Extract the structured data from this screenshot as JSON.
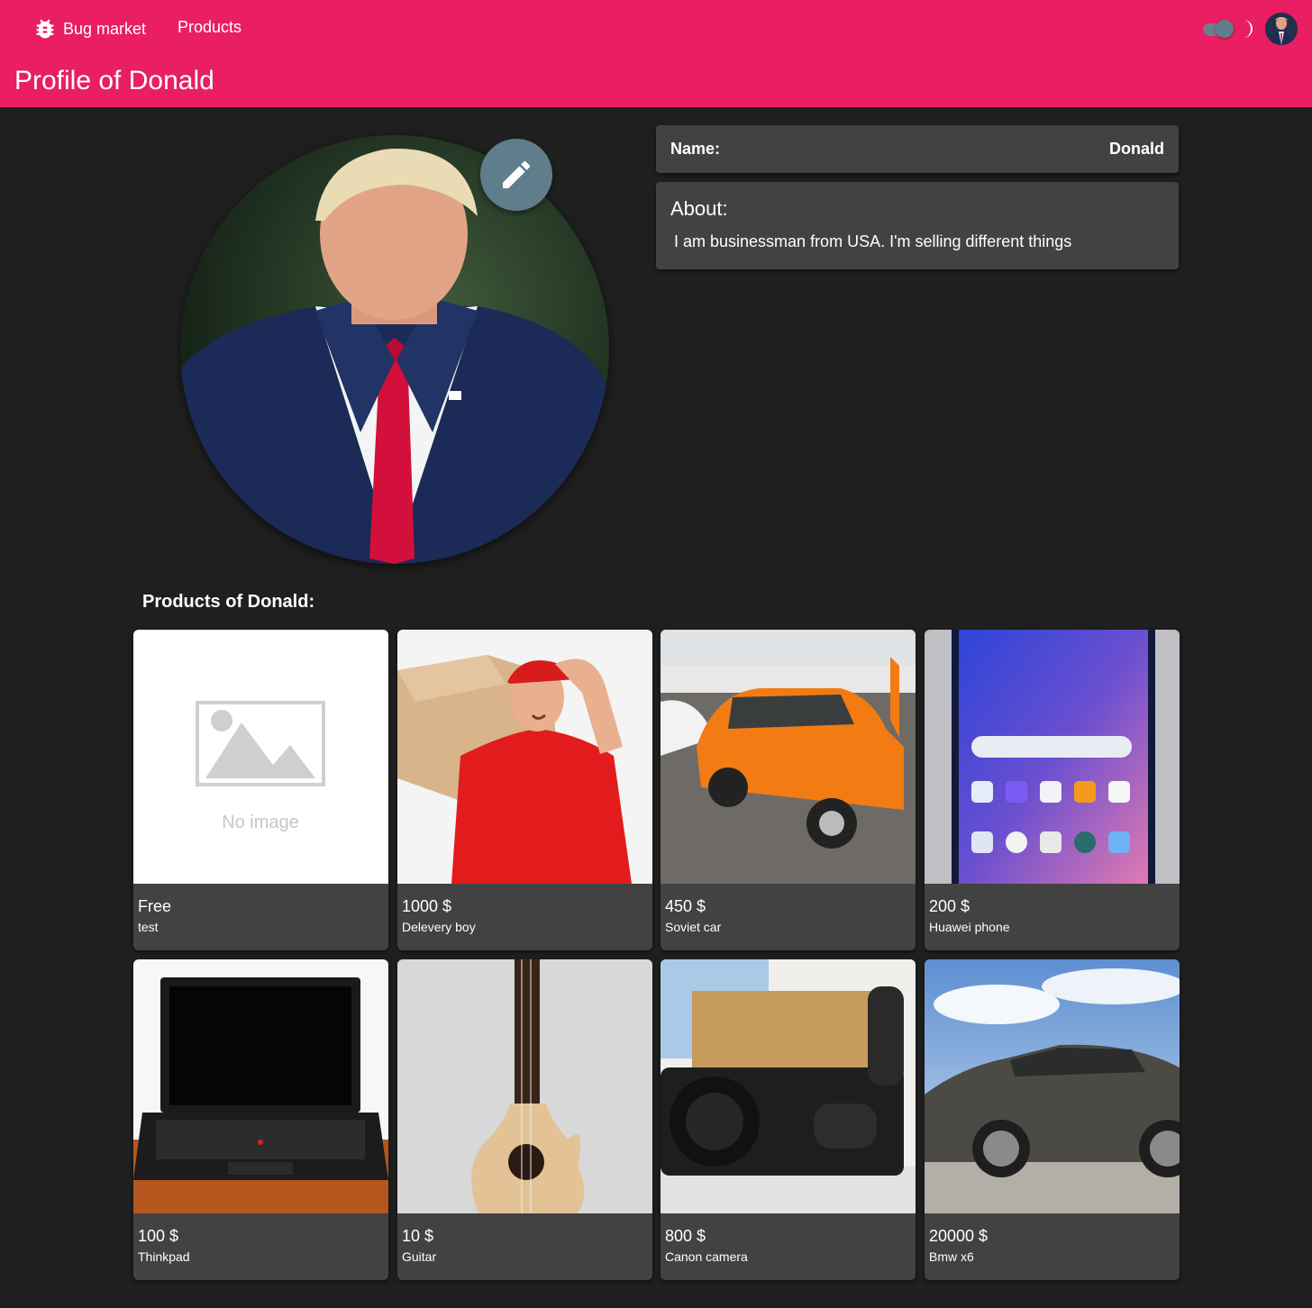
{
  "header": {
    "brand": "Bug market",
    "nav_products": "Products",
    "page_title": "Profile of Donald"
  },
  "profile": {
    "name_label": "Name:",
    "name_value": "Donald",
    "about_label": "About:",
    "about_text": "I am businessman from USA. I'm selling different things"
  },
  "products_heading": "Products of Donald:",
  "products": [
    {
      "price": "Free",
      "name": "test",
      "image": "no-image-placeholder",
      "placeholder_text": "No image"
    },
    {
      "price": "1000 $",
      "name": "Delevery boy",
      "image": "delivery-boy-photo"
    },
    {
      "price": "450 $",
      "name": "Soviet car",
      "image": "orange-car-photo"
    },
    {
      "price": "200 $",
      "name": "Huawei phone",
      "image": "phone-photo"
    },
    {
      "price": "100 $",
      "name": "Thinkpad",
      "image": "laptop-photo"
    },
    {
      "price": "10 $",
      "name": "Guitar",
      "image": "guitar-photo"
    },
    {
      "price": "800 $",
      "name": "Canon camera",
      "image": "camera-photo"
    },
    {
      "price": "20000 $",
      "name": "Bmw x6",
      "image": "suv-photo"
    }
  ],
  "colors": {
    "primary": "#e91e63",
    "background": "#1f1f1f",
    "card": "#424242",
    "fab": "#607d8b"
  }
}
